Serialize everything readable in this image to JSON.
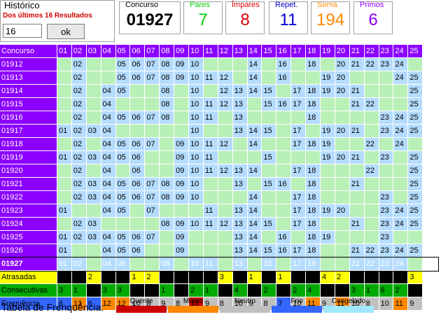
{
  "historico": {
    "title": "Histórico",
    "subtitle": "Dos últimos 16 Resultados",
    "input_value": "16",
    "ok_label": "ok"
  },
  "stats": [
    {
      "label": "Concurso",
      "value": "01927",
      "label_color": "#000000",
      "value_color": "#000000"
    },
    {
      "label": "Pares",
      "value": "7",
      "label_color": "#00cc00",
      "value_color": "#00cc00"
    },
    {
      "label": "Ímpares",
      "value": "8",
      "label_color": "#e00000",
      "value_color": "#e00000"
    },
    {
      "label": "Repet.",
      "value": "11",
      "label_color": "#0000cc",
      "value_color": "#0000cc"
    },
    {
      "label": "Soma",
      "value": "194",
      "label_color": "#ff8800",
      "value_color": "#ff8800"
    },
    {
      "label": "Primos",
      "value": "6",
      "label_color": "#8b00ff",
      "value_color": "#8b00ff"
    }
  ],
  "grid": {
    "header_label": "Concurso",
    "numbers": [
      "01",
      "02",
      "03",
      "04",
      "05",
      "06",
      "07",
      "08",
      "09",
      "10",
      "11",
      "12",
      "13",
      "14",
      "15",
      "16",
      "17",
      "18",
      "19",
      "20",
      "21",
      "22",
      "23",
      "24",
      "25"
    ],
    "rows": [
      {
        "concurso": "01912",
        "hits": [
          "02",
          "05",
          "06",
          "07",
          "08",
          "09",
          "10",
          "14",
          "16",
          "18",
          "20",
          "21",
          "22",
          "23",
          "24"
        ]
      },
      {
        "concurso": "01913",
        "hits": [
          "02",
          "05",
          "06",
          "07",
          "08",
          "09",
          "10",
          "11",
          "12",
          "14",
          "16",
          "19",
          "20",
          "24",
          "25"
        ]
      },
      {
        "concurso": "01914",
        "hits": [
          "02",
          "04",
          "05",
          "08",
          "10",
          "12",
          "13",
          "14",
          "15",
          "17",
          "18",
          "19",
          "20",
          "21",
          "25"
        ]
      },
      {
        "concurso": "01915",
        "hits": [
          "02",
          "04",
          "08",
          "10",
          "11",
          "12",
          "13",
          "15",
          "16",
          "17",
          "18",
          "21",
          "22",
          "25"
        ]
      },
      {
        "concurso": "01916",
        "hits": [
          "02",
          "04",
          "05",
          "06",
          "07",
          "08",
          "10",
          "11",
          "13",
          "18",
          "23",
          "24",
          "25"
        ]
      },
      {
        "concurso": "01917",
        "hits": [
          "01",
          "02",
          "03",
          "04",
          "10",
          "13",
          "14",
          "15",
          "17",
          "19",
          "20",
          "21",
          "23",
          "24",
          "25"
        ]
      },
      {
        "concurso": "01918",
        "hits": [
          "02",
          "04",
          "05",
          "06",
          "07",
          "09",
          "10",
          "11",
          "12",
          "14",
          "17",
          "18",
          "19",
          "22",
          "24"
        ]
      },
      {
        "concurso": "01919",
        "hits": [
          "01",
          "02",
          "03",
          "04",
          "05",
          "06",
          "09",
          "10",
          "11",
          "15",
          "19",
          "20",
          "21",
          "23",
          "25"
        ]
      },
      {
        "concurso": "01920",
        "hits": [
          "02",
          "04",
          "06",
          "09",
          "10",
          "11",
          "12",
          "13",
          "14",
          "17",
          "18",
          "22",
          "25"
        ]
      },
      {
        "concurso": "01921",
        "hits": [
          "02",
          "03",
          "04",
          "05",
          "06",
          "07",
          "08",
          "09",
          "10",
          "13",
          "15",
          "16",
          "18",
          "21",
          "25"
        ]
      },
      {
        "concurso": "01922",
        "hits": [
          "02",
          "03",
          "04",
          "05",
          "06",
          "07",
          "08",
          "09",
          "10",
          "14",
          "17",
          "18",
          "23",
          "25"
        ]
      },
      {
        "concurso": "01923",
        "hits": [
          "01",
          "04",
          "05",
          "07",
          "11",
          "13",
          "14",
          "17",
          "18",
          "19",
          "20",
          "23",
          "24",
          "25"
        ]
      },
      {
        "concurso": "01924",
        "hits": [
          "02",
          "03",
          "08",
          "09",
          "10",
          "11",
          "12",
          "13",
          "14",
          "15",
          "17",
          "18",
          "21",
          "23",
          "24",
          "25"
        ]
      },
      {
        "concurso": "01925",
        "hits": [
          "01",
          "02",
          "03",
          "04",
          "05",
          "06",
          "07",
          "09",
          "13",
          "14",
          "16",
          "18",
          "19",
          "23"
        ]
      },
      {
        "concurso": "01926",
        "hits": [
          "01",
          "04",
          "05",
          "06",
          "09",
          "13",
          "14",
          "15",
          "16",
          "17",
          "18",
          "21",
          "22",
          "23",
          "24",
          "25"
        ]
      },
      {
        "concurso": "01927",
        "hits": [
          "01",
          "02",
          "04",
          "05",
          "08",
          "10",
          "11",
          "13",
          "15",
          "17",
          "18",
          "21",
          "22",
          "23",
          "24"
        ]
      }
    ],
    "atrasadas": {
      "label": "Atrasadas",
      "values": [
        "",
        "",
        "2",
        "",
        "",
        "1",
        "2",
        "",
        "",
        "",
        "",
        "3",
        "",
        "1",
        "",
        "1",
        "",
        "",
        "4",
        "2",
        "",
        "",
        "",
        "",
        "3"
      ]
    },
    "consecutivas": {
      "label": "Consecutivas",
      "values": [
        "3",
        "1",
        "",
        "3",
        "3",
        "",
        "",
        "1",
        "",
        "2",
        "1",
        "",
        "4",
        "",
        "2",
        "",
        "2",
        "4",
        "",
        "",
        "3",
        "1",
        "6",
        "2",
        ""
      ]
    },
    "frequencia": {
      "label": "Frequência",
      "values": [
        "6",
        "13",
        "6",
        "12",
        "12",
        "10",
        "8",
        "9",
        "8",
        "15",
        "9",
        "8",
        "10",
        "9",
        "8",
        "7",
        "10",
        "11",
        "9",
        "11",
        "10",
        "8",
        "10",
        "11",
        "9"
      ]
    },
    "colors": {
      "hit": "#b5dcff",
      "miss": "#b8f0b8",
      "quente": "#cc0000",
      "morno": "#ff8800",
      "neutro": "#c0c0c0",
      "frio": "#3366ff",
      "congelado": "#a0e8ff",
      "atr_on": "#ffff00",
      "atr_off": "#000000",
      "con_on": "#00aa00",
      "con_off": "#000000"
    }
  },
  "legend": {
    "title": "Tabela de Frenquência:",
    "items": [
      {
        "label": "Quente",
        "color": "#cc0000"
      },
      {
        "label": "Morno",
        "color": "#ff8800"
      },
      {
        "label": "Neutro",
        "color": "#c0c0c0"
      },
      {
        "label": "Frio",
        "color": "#3366ff"
      },
      {
        "label": "Congelado",
        "color": "#a0e8ff"
      }
    ]
  }
}
